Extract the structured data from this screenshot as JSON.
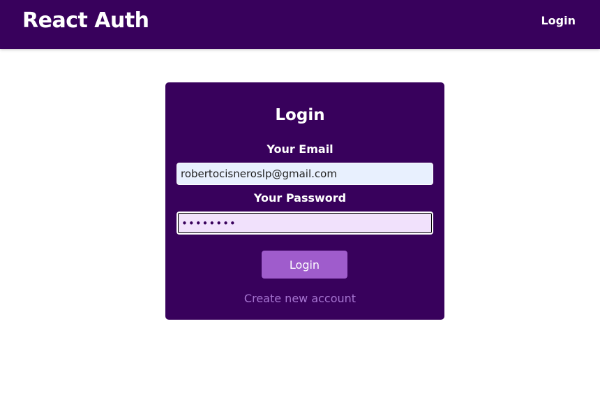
{
  "header": {
    "logo": "React Auth",
    "nav_login": "Login"
  },
  "form": {
    "title": "Login",
    "email_label": "Your Email",
    "email_value": "robertocisneroslp@gmail.com",
    "password_label": "Your Password",
    "password_value": "••••••••",
    "submit_label": "Login",
    "toggle_label": "Create new account"
  },
  "colors": {
    "header_bg": "#38015c",
    "card_bg": "#38015c",
    "button_bg": "#9f5ccc",
    "link": "#a675d1",
    "email_input_bg": "#e8f0fe",
    "password_input_bg": "#f1e1fc"
  }
}
